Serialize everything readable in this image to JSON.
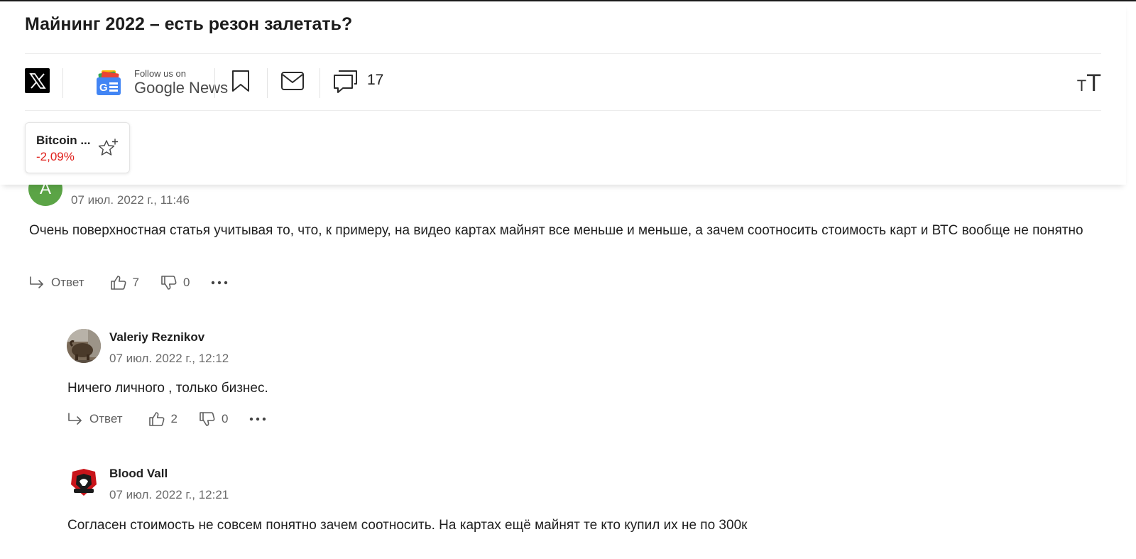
{
  "article": {
    "title": "Майнинг 2022 – есть резон залетать?"
  },
  "share_bar": {
    "x_icon": "x-logo-icon",
    "google_news_small": "Follow us on",
    "google_news_big": "Google News",
    "comment_count": "17"
  },
  "ticker": {
    "name": "Bitcoin ...",
    "change": "-2,09%",
    "change_color": "#e0201b"
  },
  "comments": [
    {
      "avatar_letter": "A",
      "avatar_color": "#5ba446",
      "date": "07 июл. 2022 г., 11:46",
      "text": "Очень поверхностная статья учитывая то, что, к примеру, на видео картах майнят все меньше и меньше, а зачем соотносить стоимость карт и ВТС вообще не понятно",
      "reply_label": "Ответ",
      "likes": "7",
      "dislikes": "0"
    },
    {
      "author": "Valeriy Reznikov",
      "date": "07 июл. 2022 г., 12:12",
      "text": "Ничего личного , только бизнес.",
      "reply_label": "Ответ",
      "likes": "2",
      "dislikes": "0"
    },
    {
      "author": "Blood Vall",
      "date": "07 июл. 2022 г., 12:21",
      "text": "Согласен стоимость не совсем понятно зачем соотносить. На картах ещё майнят те кто купил их не по 300к"
    }
  ]
}
